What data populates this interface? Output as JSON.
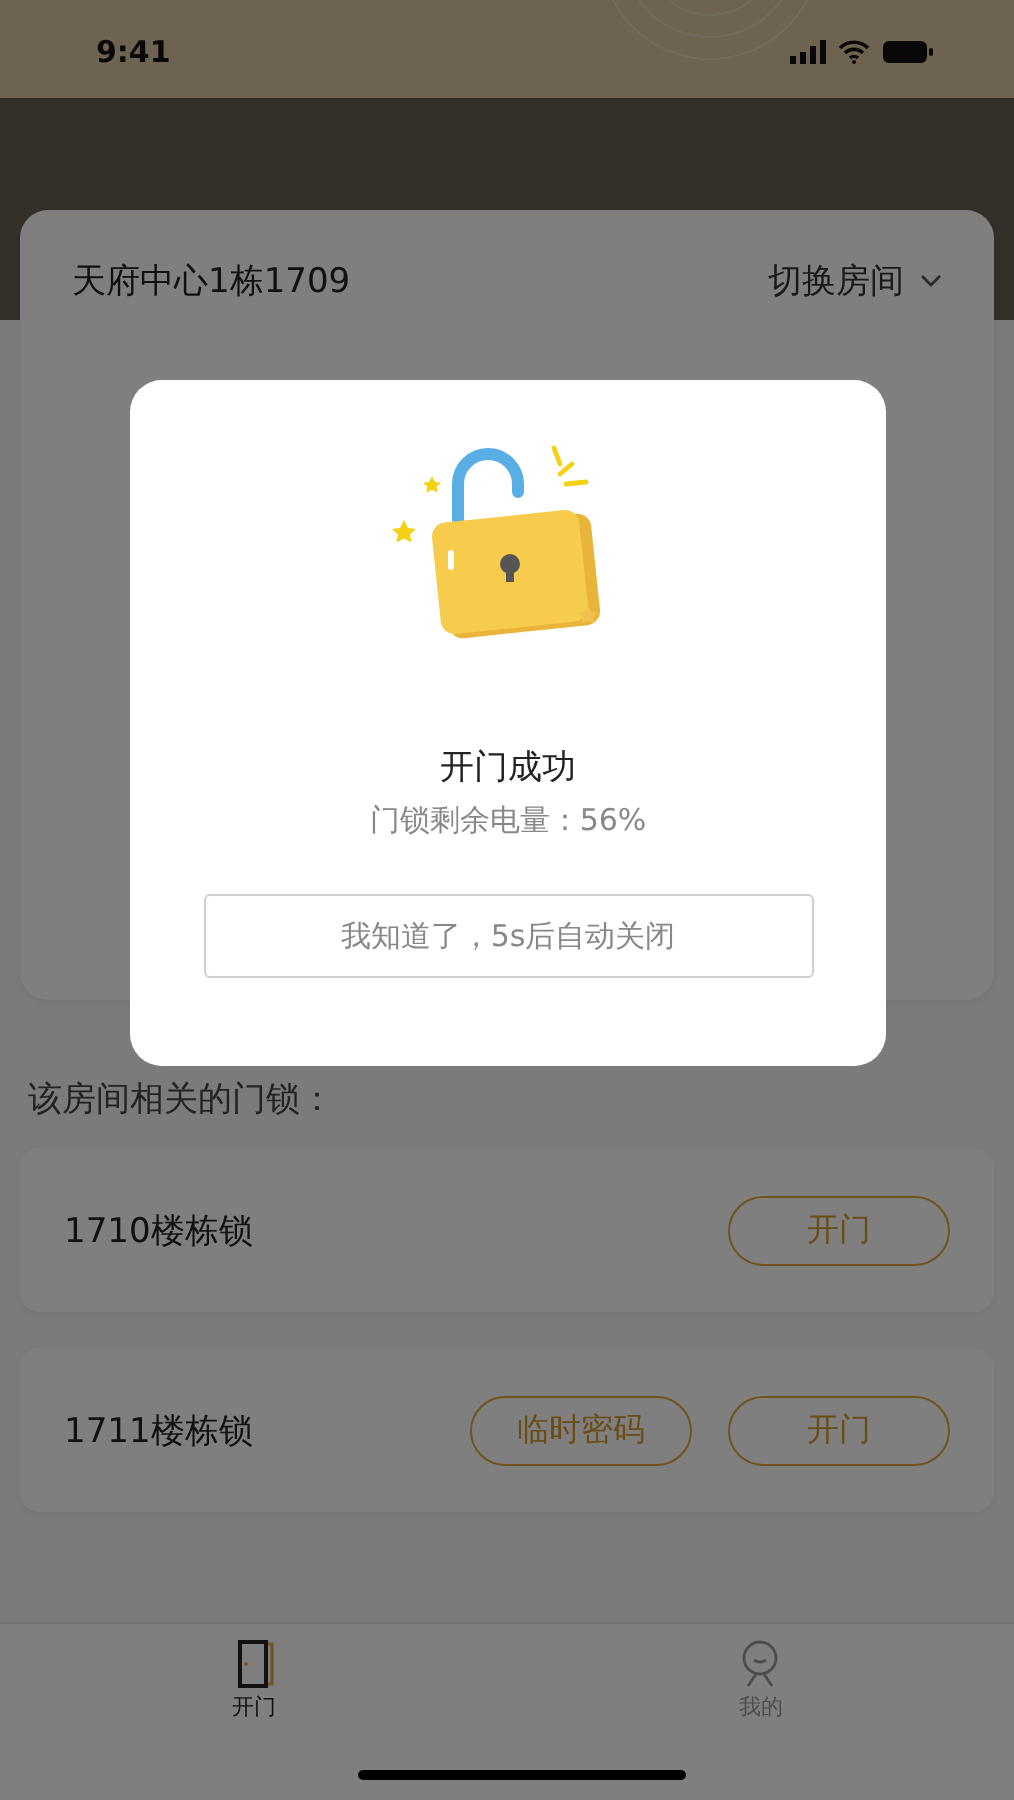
{
  "status_bar": {
    "time": "9:41"
  },
  "room": {
    "name": "天府中心1栋1709",
    "switch_label": "切换房间"
  },
  "section_label": "该房间相关的门锁：",
  "locks": [
    {
      "name": "1710楼栋锁",
      "actions": [
        "开门"
      ]
    },
    {
      "name": "1711楼栋锁",
      "actions": [
        "临时密码",
        "开门"
      ]
    }
  ],
  "tabs": [
    {
      "kind": "door",
      "label": "开门",
      "selected": true
    },
    {
      "kind": "profile",
      "label": "我的",
      "selected": false
    }
  ],
  "dialog": {
    "title": "开门成功",
    "battery_text": "门锁剩余电量：56%",
    "confirm_button": "我知道了，5s后自动关闭"
  }
}
